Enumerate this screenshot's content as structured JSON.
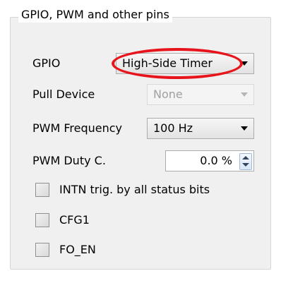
{
  "group": {
    "title": "GPIO, PWM and other pins"
  },
  "gpio": {
    "label": "GPIO",
    "value": "High-Side Timer"
  },
  "pull_device": {
    "label": "Pull Device",
    "value": "None",
    "enabled": false
  },
  "pwm_frequency": {
    "label": "PWM Frequency",
    "value": "100 Hz"
  },
  "pwm_duty": {
    "label": "PWM Duty C.",
    "value": "0.0 %"
  },
  "checkboxes": [
    {
      "label": "INTN trig. by all status bits",
      "checked": false
    },
    {
      "label": "CFG1",
      "checked": false
    },
    {
      "label": "FO_EN",
      "checked": false
    }
  ],
  "annotation": {
    "color": "#e8141c",
    "shape": "oval highlight around GPIO selection"
  }
}
